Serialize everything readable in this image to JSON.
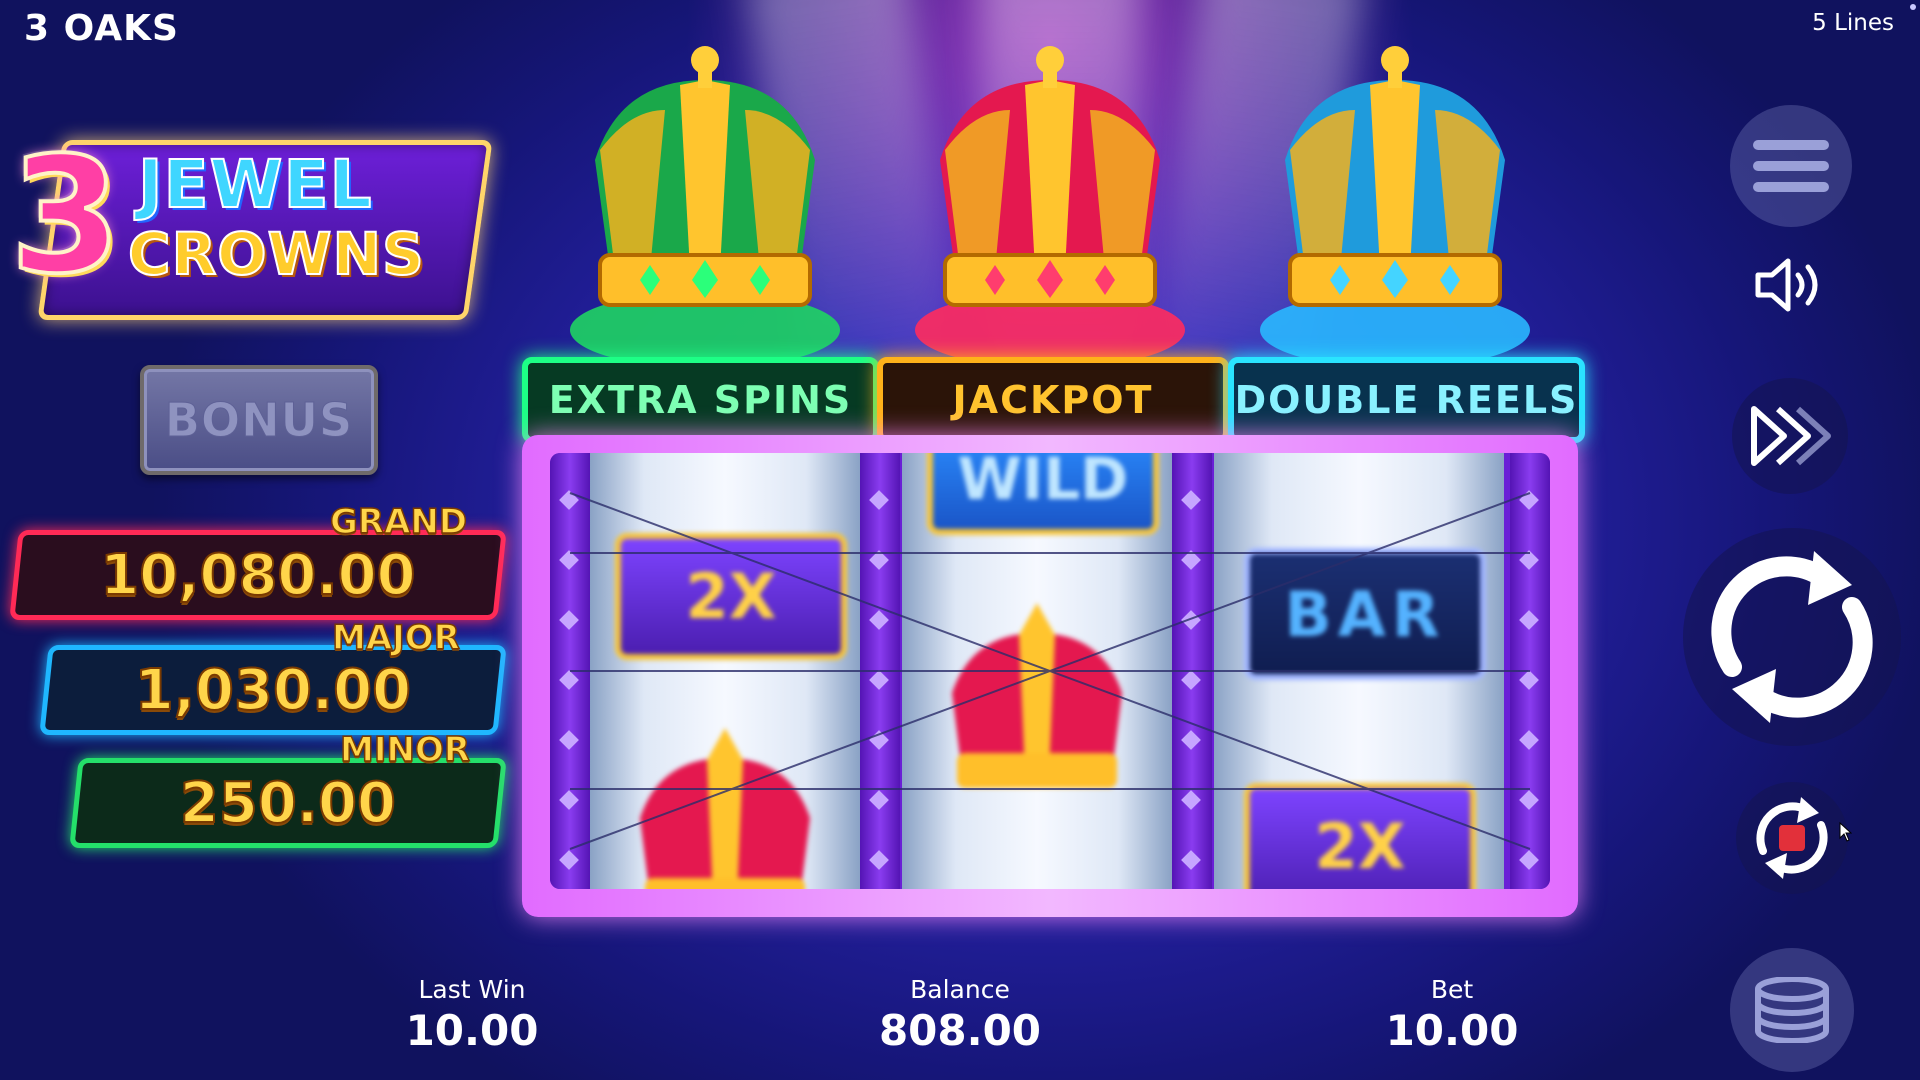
{
  "header": {
    "brand": "3 OAKS",
    "lines": "5 Lines"
  },
  "logo": {
    "number": "3",
    "word1": "JEWEL",
    "word2": "CROWNS"
  },
  "bonus": {
    "label": "BONUS"
  },
  "jackpots": {
    "grand": {
      "label": "GRAND",
      "value": "10,080.00",
      "color": "#ff2a56"
    },
    "major": {
      "label": "MAJOR",
      "value": "1,030.00",
      "color": "#1fb7ff"
    },
    "minor": {
      "label": "MINOR",
      "value": "250.00",
      "color": "#24e06a"
    }
  },
  "features": {
    "extra": "EXTRA SPINS",
    "jackpot": "JACKPOT",
    "double": "DOUBLE REELS"
  },
  "crowns": {
    "green": {
      "color": "#1aa84a",
      "gem": "#2bff7a"
    },
    "red": {
      "color": "#e4184f",
      "gem": "#ff3d6e"
    },
    "blue": {
      "color": "#1f9bdc",
      "gem": "#44d4ff"
    }
  },
  "reels": {
    "r1": [
      "2X",
      "crown"
    ],
    "r2": [
      "WILD",
      "crown"
    ],
    "r3": [
      "BAR",
      "2X"
    ]
  },
  "stats": {
    "last_win_label": "Last Win",
    "last_win": "10.00",
    "balance_label": "Balance",
    "balance": "808.00",
    "bet_label": "Bet",
    "bet": "10.00"
  },
  "controls": {
    "menu": "hamburger-icon",
    "sound": "speaker-icon",
    "turbo": "fast-forward-icon",
    "spin": "spin-arrows-icon",
    "autoplay": "autoplay-stop-icon",
    "bet_coins": "coin-stack-icon"
  }
}
